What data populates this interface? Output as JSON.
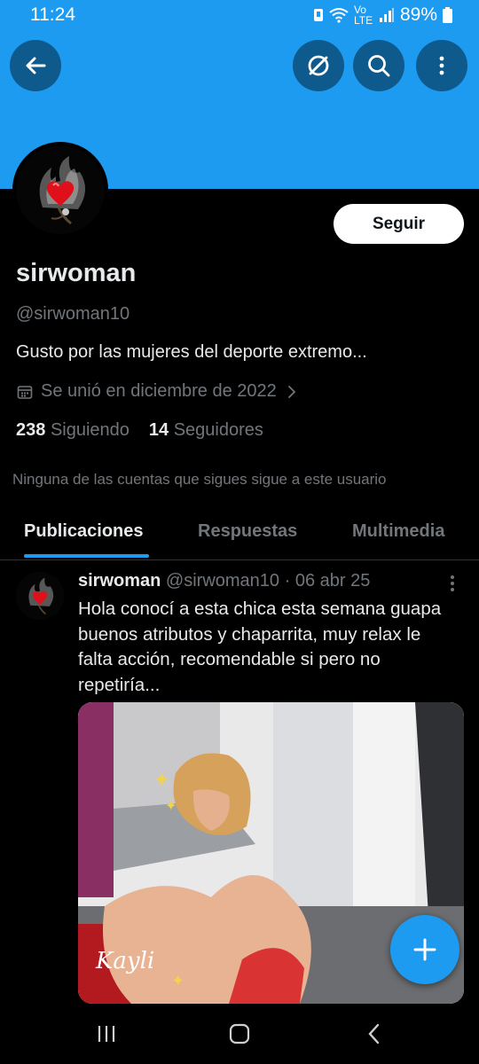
{
  "status_bar": {
    "time": "11:24",
    "network": "Vo LTE",
    "battery": "89%"
  },
  "header": {
    "back_icon": "arrow-left-icon",
    "actions": [
      "blocked-icon",
      "search-icon",
      "more-vertical-icon"
    ],
    "banner_color": "#1d9bf0"
  },
  "profile": {
    "display_name": "sirwoman",
    "handle": "@sirwoman10",
    "bio": "Gusto por las mujeres del deporte extremo...",
    "joined": "Se unió en diciembre de 2022",
    "following_count": "238",
    "following_label": "Siguiendo",
    "followers_count": "14",
    "followers_label": "Seguidores",
    "mutual_note": "Ninguna de las cuentas que sigues sigue a este usuario",
    "follow_label": "Seguir"
  },
  "tabs": [
    {
      "label": "Publicaciones",
      "active": true
    },
    {
      "label": "Respuestas",
      "active": false
    },
    {
      "label": "Multimedia",
      "active": false
    }
  ],
  "post": {
    "author_name": "sirwoman",
    "author_handle": "@sirwoman10",
    "separator": "·",
    "date": "06 abr 25",
    "text_lines": [
      "Hola conocí a esta chica esta semana guapa",
      "buenos  atributos y chaparrita, muy relax le",
      "falta acción, recomendable si pero no",
      "repetiría..."
    ],
    "media_watermark": "Kayli"
  },
  "fab": {
    "icon": "plus-icon"
  },
  "nav_bar": {
    "buttons": [
      "recents-icon",
      "home-icon",
      "back-icon"
    ]
  },
  "colors": {
    "accent": "#1d9bf0",
    "muted": "#71767b",
    "text": "#e7e9ea"
  }
}
